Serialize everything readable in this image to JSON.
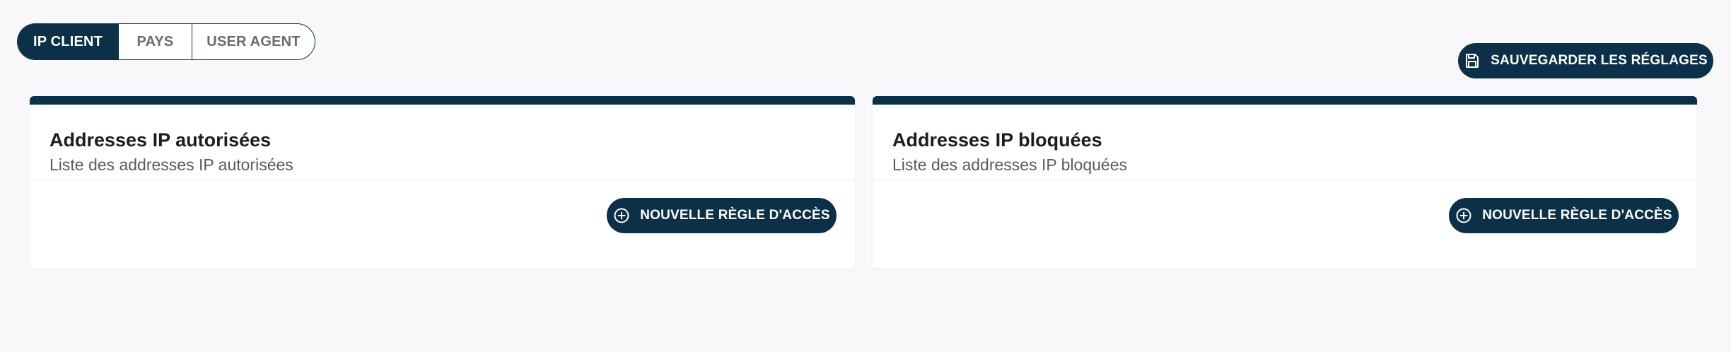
{
  "tabs": [
    {
      "label": "IP CLIENT",
      "active": true
    },
    {
      "label": "PAYS",
      "active": false
    },
    {
      "label": "USER AGENT",
      "active": false
    }
  ],
  "toolbar": {
    "save_label": "SAUVEGARDER LES RÉGLAGES",
    "save_icon": "floppy-disk-icon"
  },
  "cards": [
    {
      "title": "Addresses IP autorisées",
      "subtitle": "Liste des addresses IP autorisées",
      "button_label": "NOUVELLE RÈGLE D'ACCÈS",
      "button_icon": "plus-circle-icon"
    },
    {
      "title": "Addresses IP bloquées",
      "subtitle": "Liste des addresses IP bloquées",
      "button_label": "NOUVELLE RÈGLE D'ACCÈS",
      "button_icon": "plus-circle-icon"
    }
  ],
  "colors": {
    "primary": "#0b3048",
    "background": "#f8f8fa",
    "card": "#ffffff"
  }
}
